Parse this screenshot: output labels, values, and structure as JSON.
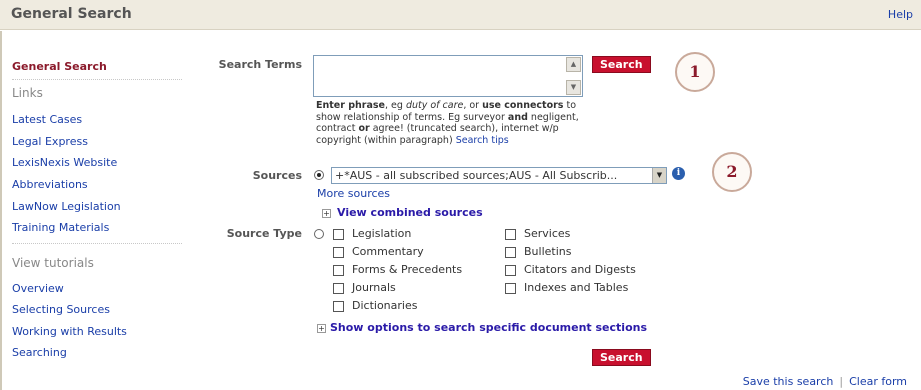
{
  "header": {
    "title": "General Search",
    "help": "Help"
  },
  "sidebar": {
    "active": "General Search",
    "links_heading": "Links",
    "links": [
      "Latest Cases",
      "Legal Express",
      "LexisNexis Website",
      "Abbreviations",
      "LawNow Legislation",
      "Training Materials"
    ],
    "tutorials_heading": "View tutorials",
    "tutorials": [
      "Overview",
      "Selecting Sources",
      "Working with Results",
      "Searching"
    ]
  },
  "search": {
    "label": "Search Terms",
    "value": "",
    "button": "Search",
    "hint": {
      "p1": "Enter phrase",
      "p2": ", eg ",
      "p3": "duty of care",
      "p4": ", or ",
      "p5": "use connectors",
      "p6": " to show relationship of terms. Eg surveyor ",
      "p7": "and",
      "p8": " negligent, contract ",
      "p9": "or",
      "p10": " agree! (truncated search), internet w/p copyright (within paragraph) ",
      "tips": "Search tips"
    }
  },
  "callouts": [
    "1",
    "2"
  ],
  "sources": {
    "label": "Sources",
    "selected": "+*AUS - all subscribed sources;AUS - All Subscrib...",
    "more": "More sources",
    "combined": "View combined sources"
  },
  "source_type": {
    "label": "Source Type",
    "col1": [
      "Legislation",
      "Commentary",
      "Forms & Precedents",
      "Journals",
      "Dictionaries"
    ],
    "col2": [
      "Services",
      "Bulletins",
      "Citators and Digests",
      "Indexes and Tables"
    ]
  },
  "options_link": "Show options to search specific document sections",
  "bottom_search": "Search",
  "footer": {
    "save": "Save this search",
    "sep": "|",
    "clear": "Clear form"
  },
  "colors": {
    "brand_red": "#c8102e",
    "link_blue": "#1a3ea8",
    "header_bg": "#efebe0",
    "active_nav": "#8b1a2b"
  },
  "icons": [
    "info-icon",
    "expand-plus-icon",
    "scroll-up-icon",
    "scroll-down-icon",
    "dropdown-arrow-icon"
  ]
}
